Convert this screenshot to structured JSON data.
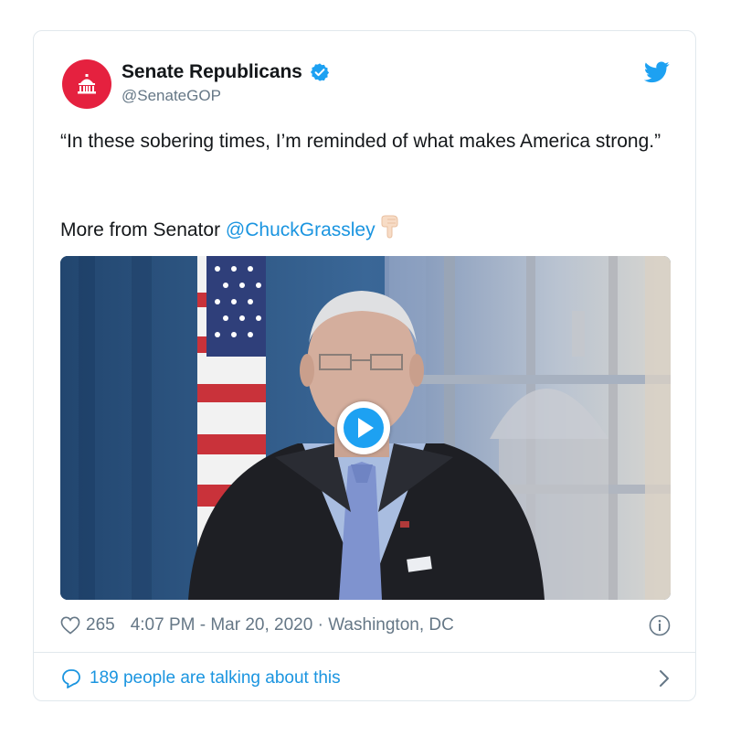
{
  "account": {
    "name": "Senate Republicans",
    "handle": "@SenateGOP",
    "avatar_color": "#e5213f",
    "verified_color": "#1da1f2"
  },
  "tweet": {
    "text": "“In these sobering times, I’m reminded of what makes America strong.”",
    "more_prefix": "More from Senator ",
    "mention": "@ChuckGrassley",
    "pointer_icon": "backhand-index-pointing-down"
  },
  "media": {
    "type": "video",
    "play_icon": "play-icon"
  },
  "meta": {
    "likes": "265",
    "timestamp": "4:07 PM - Mar 20, 2020",
    "separator": " · ",
    "location": "Washington, DC"
  },
  "conversation": {
    "label": "189 people are talking about this"
  },
  "colors": {
    "link": "#1b95e0",
    "muted": "#657786",
    "border": "#e1e8ed"
  }
}
